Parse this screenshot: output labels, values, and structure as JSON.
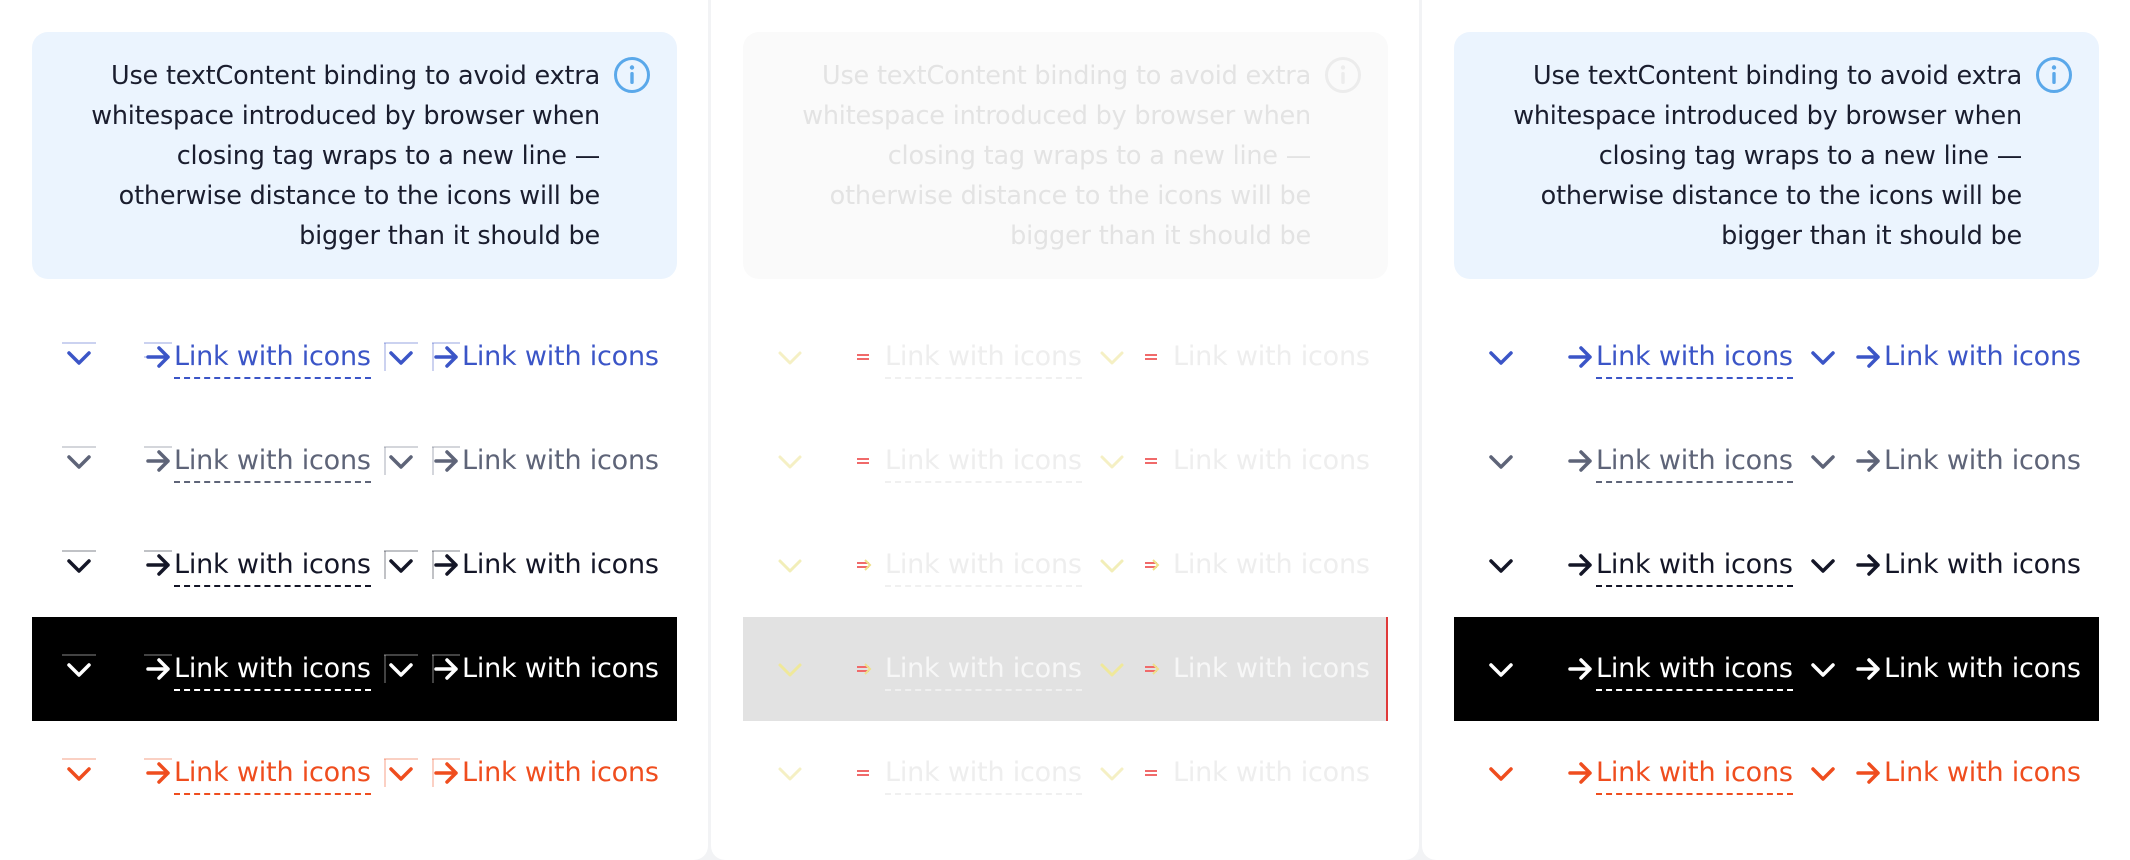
{
  "notice": {
    "text": "Use textContent binding to avoid extra whitespace introduced by browser when closing tag wraps to a new line — otherwise distance to the icons will be bigger than it should be"
  },
  "link_label": "Link with icons",
  "themes": {
    "blue": "#3b55c7",
    "gray": "#5e6478",
    "dark": "#141627",
    "white_on_black": "#ffffff",
    "orange": "#ef4d1e",
    "notice_background": "#ebf4fe",
    "info_icon": "#5aa8ea",
    "faded_highlight_border": "#e03a3a"
  },
  "icons": {
    "leading": "chevron-down-icon",
    "trailing": "arrow-right-icon",
    "notice": "info-icon"
  },
  "panels": [
    {
      "name": "panel-1",
      "rows": [
        "blue",
        "gray",
        "dark",
        "white_on_black",
        "orange"
      ]
    },
    {
      "name": "panel-2",
      "rows": [
        "faded",
        "faded",
        "faded",
        "faded-highlight",
        "faded"
      ]
    },
    {
      "name": "panel-3",
      "rows": [
        "blue",
        "gray",
        "dark",
        "white_on_black",
        "orange"
      ]
    }
  ]
}
